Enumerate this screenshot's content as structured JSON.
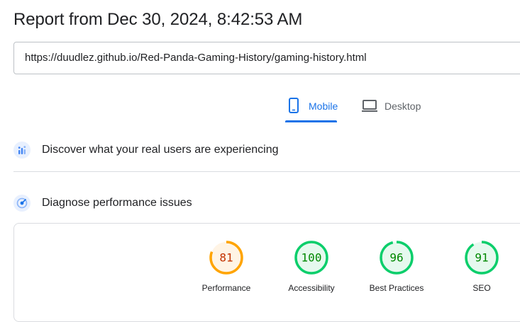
{
  "report": {
    "title": "Report from Dec 30, 2024, 8:42:53 AM",
    "url": "https://duudlez.github.io/Red-Panda-Gaming-History/gaming-history.html"
  },
  "tabs": [
    {
      "label": "Mobile",
      "icon": "smartphone-icon",
      "selected": true
    },
    {
      "label": "Desktop",
      "icon": "laptop-icon",
      "selected": false
    }
  ],
  "sections": {
    "crux": {
      "label": "Discover what your real users are experiencing",
      "icon": "users-chart-icon"
    },
    "diagnose": {
      "label": "Diagnose performance issues",
      "icon": "diagnose-icon"
    }
  },
  "scores": [
    {
      "label": "Performance",
      "value": 81,
      "status": "average"
    },
    {
      "label": "Accessibility",
      "value": 100,
      "status": "pass"
    },
    {
      "label": "Best Practices",
      "value": 96,
      "status": "pass"
    },
    {
      "label": "SEO",
      "value": 91,
      "status": "pass"
    }
  ],
  "colors": {
    "accent": "#1a73e8",
    "pass_stroke": "#0cce6b",
    "pass_fill": "#e6f9ee",
    "pass_text": "#008800",
    "average_stroke": "#ffa400",
    "average_fill": "#fff4e5",
    "average_text": "#c33300"
  }
}
